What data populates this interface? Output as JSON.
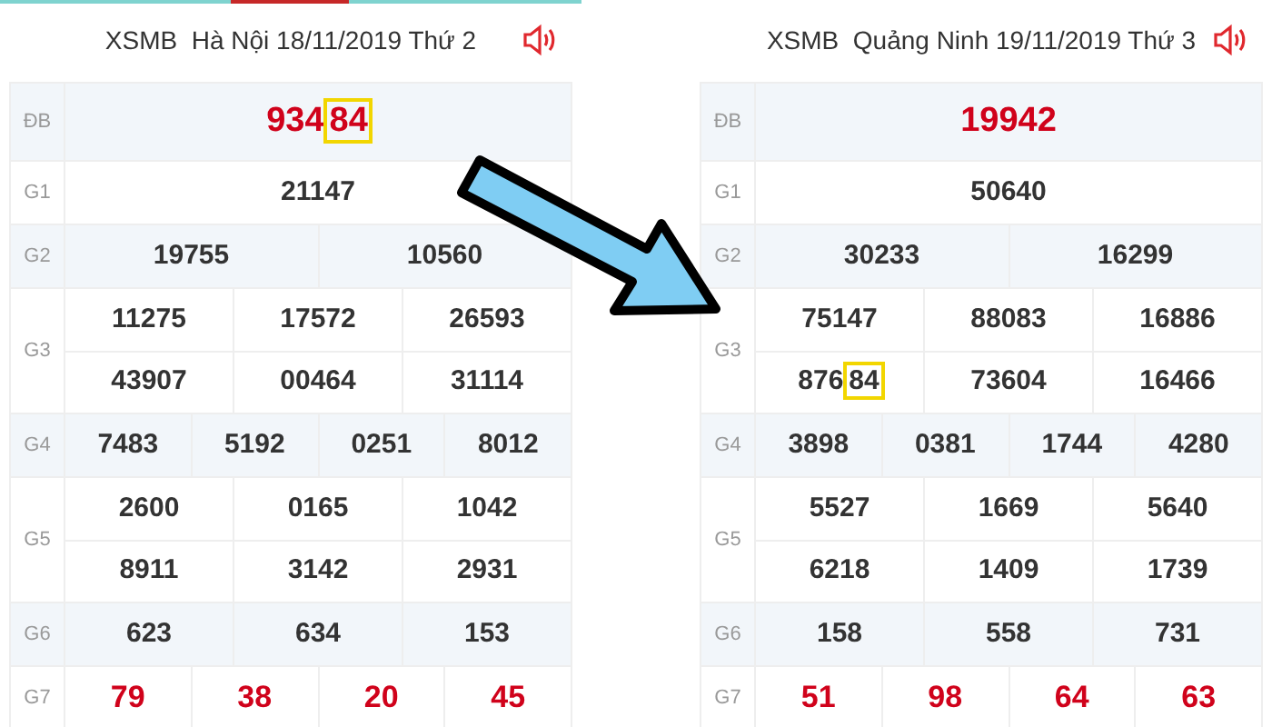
{
  "panels": [
    {
      "title": "XSMB  Hà Nội 18/11/2019 Thứ 2",
      "rows": [
        {
          "label": "ĐB",
          "accent": true,
          "lines": [
            [
              {
                "text": "934",
                "boxed": "84"
              }
            ]
          ]
        },
        {
          "label": "G1",
          "accent": false,
          "lines": [
            [
              {
                "text": "21147"
              }
            ]
          ]
        },
        {
          "label": "G2",
          "accent": false,
          "lines": [
            [
              {
                "text": "19755"
              },
              {
                "text": "10560"
              }
            ]
          ]
        },
        {
          "label": "G3",
          "accent": false,
          "lines": [
            [
              {
                "text": "11275"
              },
              {
                "text": "17572"
              },
              {
                "text": "26593"
              }
            ],
            [
              {
                "text": "43907"
              },
              {
                "text": "00464"
              },
              {
                "text": "31114"
              }
            ]
          ]
        },
        {
          "label": "G4",
          "accent": false,
          "lines": [
            [
              {
                "text": "7483"
              },
              {
                "text": "5192"
              },
              {
                "text": "0251"
              },
              {
                "text": "8012"
              }
            ]
          ]
        },
        {
          "label": "G5",
          "accent": false,
          "lines": [
            [
              {
                "text": "2600"
              },
              {
                "text": "0165"
              },
              {
                "text": "1042"
              }
            ],
            [
              {
                "text": "8911"
              },
              {
                "text": "3142"
              },
              {
                "text": "2931"
              }
            ]
          ]
        },
        {
          "label": "G6",
          "accent": false,
          "lines": [
            [
              {
                "text": "623"
              },
              {
                "text": "634"
              },
              {
                "text": "153"
              }
            ]
          ]
        },
        {
          "label": "G7",
          "accent": true,
          "lines": [
            [
              {
                "text": "79"
              },
              {
                "text": "38"
              },
              {
                "text": "20"
              },
              {
                "text": "45"
              }
            ]
          ]
        }
      ]
    },
    {
      "title": "XSMB  Quảng Ninh 19/11/2019 Thứ 3",
      "rows": [
        {
          "label": "ĐB",
          "accent": true,
          "lines": [
            [
              {
                "text": "19942"
              }
            ]
          ]
        },
        {
          "label": "G1",
          "accent": false,
          "lines": [
            [
              {
                "text": "50640"
              }
            ]
          ]
        },
        {
          "label": "G2",
          "accent": false,
          "lines": [
            [
              {
                "text": "30233"
              },
              {
                "text": "16299"
              }
            ]
          ]
        },
        {
          "label": "G3",
          "accent": false,
          "lines": [
            [
              {
                "text": "75147"
              },
              {
                "text": "88083"
              },
              {
                "text": "16886"
              }
            ],
            [
              {
                "text": "876",
                "boxed": "84"
              },
              {
                "text": "73604"
              },
              {
                "text": "16466"
              }
            ]
          ]
        },
        {
          "label": "G4",
          "accent": false,
          "lines": [
            [
              {
                "text": "3898"
              },
              {
                "text": "0381"
              },
              {
                "text": "1744"
              },
              {
                "text": "4280"
              }
            ]
          ]
        },
        {
          "label": "G5",
          "accent": false,
          "lines": [
            [
              {
                "text": "5527"
              },
              {
                "text": "1669"
              },
              {
                "text": "5640"
              }
            ],
            [
              {
                "text": "6218"
              },
              {
                "text": "1409"
              },
              {
                "text": "1739"
              }
            ]
          ]
        },
        {
          "label": "G6",
          "accent": false,
          "lines": [
            [
              {
                "text": "158"
              },
              {
                "text": "558"
              },
              {
                "text": "731"
              }
            ]
          ]
        },
        {
          "label": "G7",
          "accent": true,
          "lines": [
            [
              {
                "text": "51"
              },
              {
                "text": "98"
              },
              {
                "text": "64"
              },
              {
                "text": "63"
              }
            ]
          ]
        }
      ]
    }
  ]
}
